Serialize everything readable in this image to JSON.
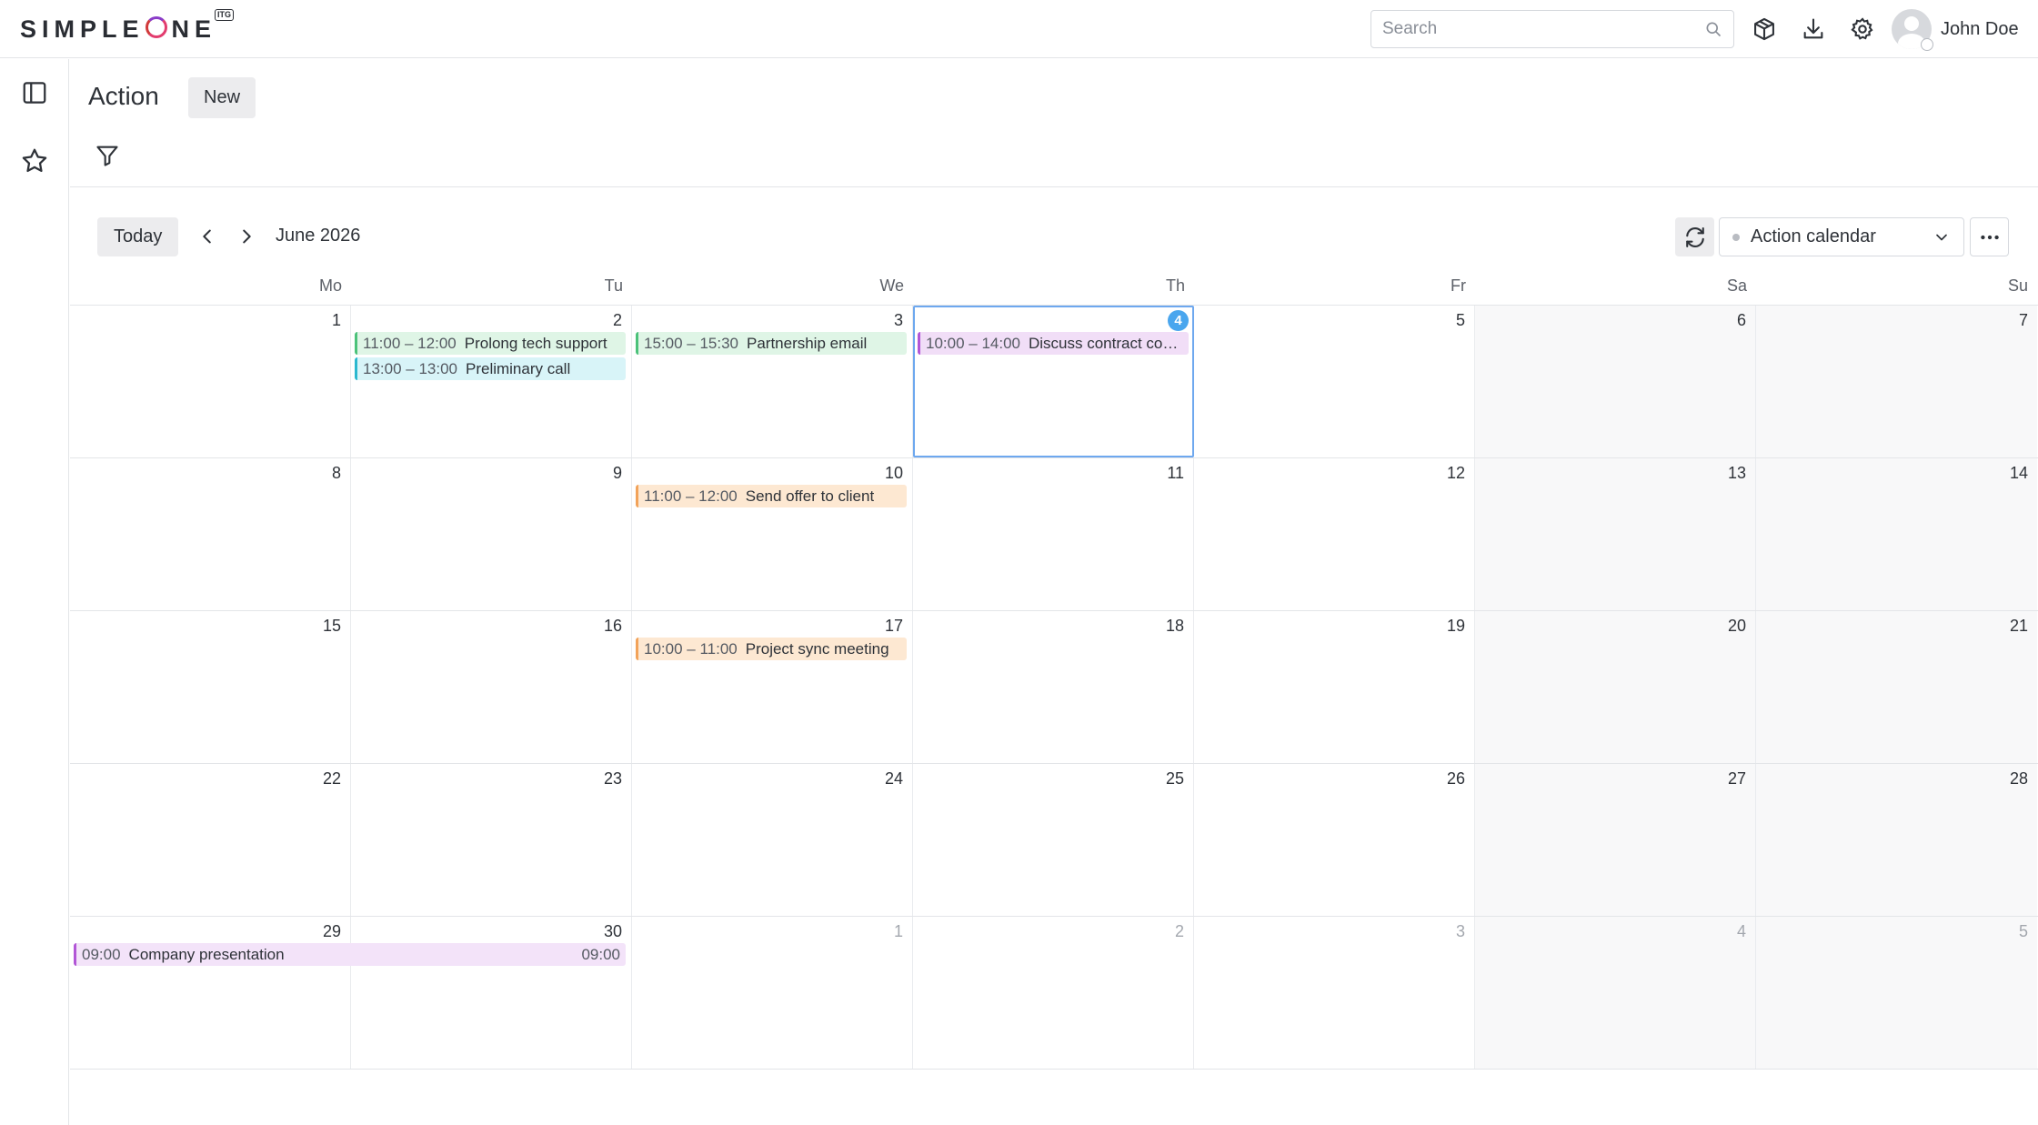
{
  "header": {
    "logo": "SIMPLEONE",
    "logo_badge": "ITG",
    "search_placeholder": "Search",
    "user_name": "John Doe"
  },
  "page": {
    "title": "Action",
    "new_label": "New"
  },
  "toolbar": {
    "today_label": "Today",
    "month_label": "June 2026",
    "calendar_select": "Action calendar"
  },
  "weekdays": [
    "Mo",
    "Tu",
    "We",
    "Th",
    "Fr",
    "Sa",
    "Su"
  ],
  "weeks": [
    [
      "1",
      "2",
      "3",
      "4",
      "5",
      "6",
      "7"
    ],
    [
      "8",
      "9",
      "10",
      "11",
      "12",
      "13",
      "14"
    ],
    [
      "15",
      "16",
      "17",
      "18",
      "19",
      "20",
      "21"
    ],
    [
      "22",
      "23",
      "24",
      "25",
      "26",
      "27",
      "28"
    ],
    [
      "29",
      "30",
      "1",
      "2",
      "3",
      "4",
      "5"
    ]
  ],
  "events": [
    {
      "time": "11:00 – 12:00",
      "title": "Prolong tech support",
      "color": "#dff5e6",
      "border": "#4cc27a"
    },
    {
      "time": "13:00 – 13:00",
      "title": "Preliminary call",
      "color": "#d8f4f8",
      "border": "#2bb8cf"
    },
    {
      "time": "15:00 – 15:30",
      "title": "Partnership email",
      "color": "#dff5e6",
      "border": "#4cc27a"
    },
    {
      "time": "10:00 – 14:00",
      "title": "Discuss contract con...",
      "color": "#f1def7",
      "border": "#b256d6"
    },
    {
      "time": "11:00 – 12:00",
      "title": "Send offer to client",
      "color": "#fde8d2",
      "border": "#f2a35a"
    },
    {
      "time": "10:00 – 11:00",
      "title": "Project sync meeting",
      "color": "#fde8d2",
      "border": "#f2a35a"
    },
    {
      "time": "09:00",
      "title": "Company presentation",
      "end_time": "09:00",
      "color": "#f3e3f9",
      "border": "#b256d6"
    }
  ],
  "colors": {
    "accent": "#4aa6ee",
    "brand_ring": "#e23c6e"
  }
}
